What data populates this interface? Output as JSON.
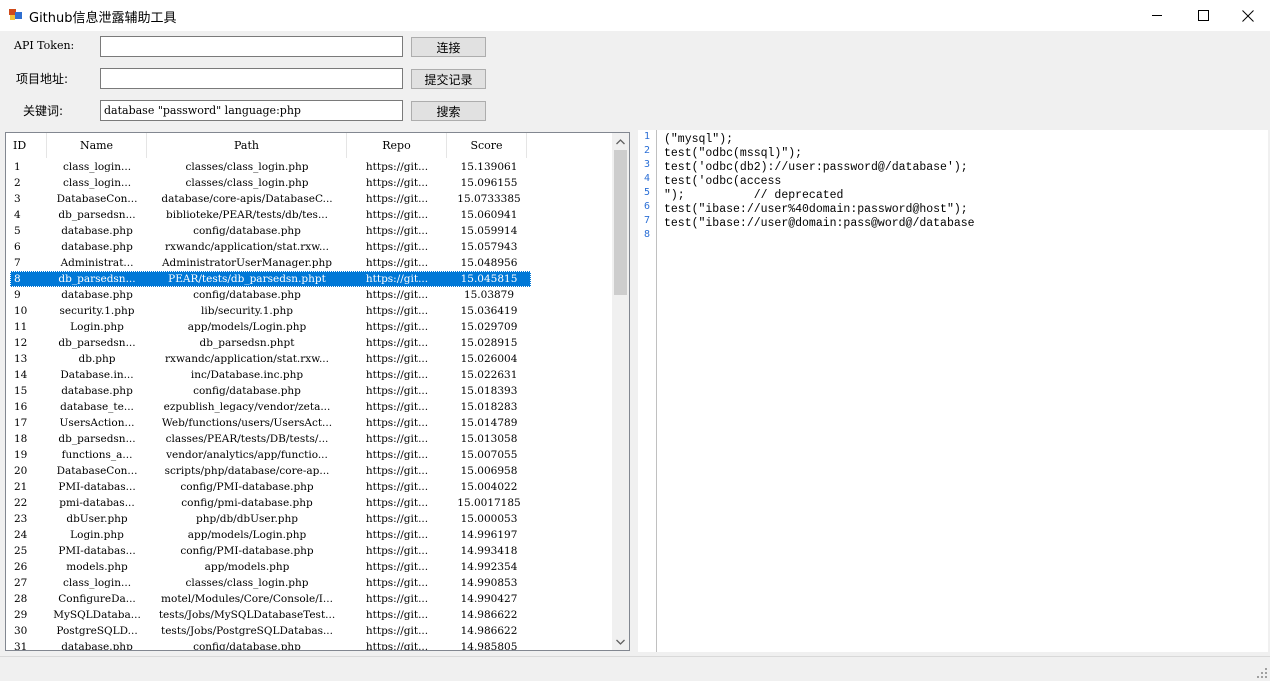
{
  "window": {
    "title": "Github信息泄露辅助工具",
    "minimize_icon": "minimize-icon",
    "maximize_icon": "maximize-icon",
    "close_icon": "close-icon"
  },
  "form": {
    "token_label": "API Token:",
    "token_value": "",
    "connect_label": "连接",
    "project_label": "项目地址:",
    "project_value": "",
    "commits_label": "提交记录",
    "keyword_label": "关键词:",
    "keyword_value": "database \"password\" language:php",
    "search_label": "搜索"
  },
  "results": {
    "columns": [
      "ID",
      "Name",
      "Path",
      "Repo",
      "Score"
    ],
    "selected_index": 7,
    "rows": [
      [
        "1",
        "class_login...",
        "classes/class_login.php",
        "https://git...",
        "15.139061"
      ],
      [
        "2",
        "class_login...",
        "classes/class_login.php",
        "https://git...",
        "15.096155"
      ],
      [
        "3",
        "DatabaseCon...",
        "database/core-apis/DatabaseC...",
        "https://git...",
        "15.0733385"
      ],
      [
        "4",
        "db_parsedsn...",
        "biblioteke/PEAR/tests/db/tes...",
        "https://git...",
        "15.060941"
      ],
      [
        "5",
        "database.php",
        "config/database.php",
        "https://git...",
        "15.059914"
      ],
      [
        "6",
        "database.php",
        "rxwandc/application/stat.rxw...",
        "https://git...",
        "15.057943"
      ],
      [
        "7",
        "Administrat...",
        "AdministratorUserManager.php",
        "https://git...",
        "15.048956"
      ],
      [
        "8",
        "db_parsedsn...",
        "PEAR/tests/db_parsedsn.phpt",
        "https://git...",
        "15.045815"
      ],
      [
        "9",
        "database.php",
        "config/database.php",
        "https://git...",
        "15.03879"
      ],
      [
        "10",
        "security.1.php",
        "lib/security.1.php",
        "https://git...",
        "15.036419"
      ],
      [
        "11",
        "Login.php",
        "app/models/Login.php",
        "https://git...",
        "15.029709"
      ],
      [
        "12",
        "db_parsedsn...",
        "db_parsedsn.phpt",
        "https://git...",
        "15.028915"
      ],
      [
        "13",
        "db.php",
        "rxwandc/application/stat.rxw...",
        "https://git...",
        "15.026004"
      ],
      [
        "14",
        "Database.in...",
        "inc/Database.inc.php",
        "https://git...",
        "15.022631"
      ],
      [
        "15",
        "database.php",
        "config/database.php",
        "https://git...",
        "15.018393"
      ],
      [
        "16",
        "database_te...",
        "ezpublish_legacy/vendor/zeta...",
        "https://git...",
        "15.018283"
      ],
      [
        "17",
        "UsersAction...",
        "Web/functions/users/UsersAct...",
        "https://git...",
        "15.014789"
      ],
      [
        "18",
        "db_parsedsn...",
        "classes/PEAR/tests/DB/tests/...",
        "https://git...",
        "15.013058"
      ],
      [
        "19",
        "functions_a...",
        "vendor/analytics/app/functio...",
        "https://git...",
        "15.007055"
      ],
      [
        "20",
        "DatabaseCon...",
        "scripts/php/database/core-ap...",
        "https://git...",
        "15.006958"
      ],
      [
        "21",
        "PMI-databas...",
        "config/PMI-database.php",
        "https://git...",
        "15.004022"
      ],
      [
        "22",
        "pmi-databas...",
        "config/pmi-database.php",
        "https://git...",
        "15.0017185"
      ],
      [
        "23",
        "dbUser.php",
        "php/db/dbUser.php",
        "https://git...",
        "15.000053"
      ],
      [
        "24",
        "Login.php",
        "app/models/Login.php",
        "https://git...",
        "14.996197"
      ],
      [
        "25",
        "PMI-databas...",
        "config/PMI-database.php",
        "https://git...",
        "14.993418"
      ],
      [
        "26",
        "models.php",
        "app/models.php",
        "https://git...",
        "14.992354"
      ],
      [
        "27",
        "class_login...",
        "classes/class_login.php",
        "https://git...",
        "14.990853"
      ],
      [
        "28",
        "ConfigureDa...",
        "motel/Modules/Core/Console/I...",
        "https://git...",
        "14.990427"
      ],
      [
        "29",
        "MySQLDataba...",
        "tests/Jobs/MySQLDatabaseTest...",
        "https://git...",
        "14.986622"
      ],
      [
        "30",
        "PostgreSQLD...",
        "tests/Jobs/PostgreSQLDatabas...",
        "https://git...",
        "14.986622"
      ],
      [
        "31",
        "database.php",
        "config/database.php",
        "https://git...",
        "14.985805"
      ]
    ]
  },
  "editor": {
    "line_numbers": [
      "1",
      "2",
      "3",
      "4",
      "5",
      "6",
      "7",
      "8"
    ],
    "lines": [
      "(\"mysql\");",
      "test(\"odbc(mssql)\");",
      "test('odbc(db2)://user:password@/database');",
      "test('odbc(access",
      "\");          // deprecated",
      "test(\"ibase://user%40domain:password@host\");",
      "test(\"ibase://user@domain:pass@word@/database",
      ""
    ]
  },
  "colors": {
    "selection": "#0078d7",
    "line_number": "#2b6fd6"
  }
}
